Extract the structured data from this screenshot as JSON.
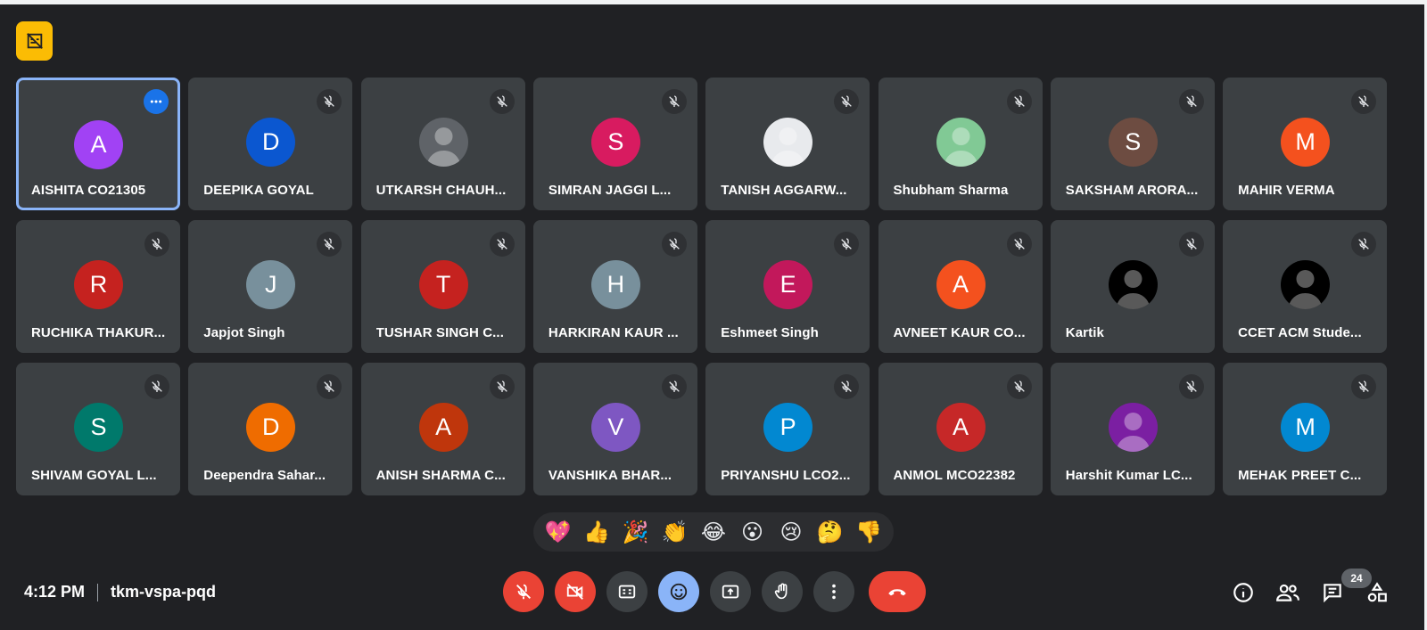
{
  "meeting": {
    "time": "4:12 PM",
    "code": "tkm-vspa-pqd",
    "participant_count": "24"
  },
  "colors": {
    "background": "#202124",
    "tile": "#3c4043",
    "accent": "#8ab4f8",
    "danger": "#ea4335",
    "badge": "#fbbc04"
  },
  "participants": [
    {
      "name": "AISHITA CO21305",
      "initial": "A",
      "color": "#a142f4",
      "active": true
    },
    {
      "name": "DEEPIKA GOYAL",
      "initial": "D",
      "color": "#0b57d0"
    },
    {
      "name": "UTKARSH CHAUH...",
      "initial": "",
      "color": "#5f6368",
      "photo": true
    },
    {
      "name": "SIMRAN JAGGI L...",
      "initial": "S",
      "color": "#d81b60"
    },
    {
      "name": "TANISH AGGARW...",
      "initial": "",
      "color": "#e8eaed",
      "photo": true
    },
    {
      "name": "Shubham Sharma",
      "initial": "",
      "color": "#81c995",
      "photo": true
    },
    {
      "name": "SAKSHAM ARORA...",
      "initial": "S",
      "color": "#6d4c41"
    },
    {
      "name": "MAHIR VERMA",
      "initial": "M",
      "color": "#f4511e"
    },
    {
      "name": "RUCHIKA THAKUR...",
      "initial": "R",
      "color": "#c5221f"
    },
    {
      "name": "Japjot Singh",
      "initial": "J",
      "color": "#78909c"
    },
    {
      "name": "TUSHAR SINGH C...",
      "initial": "T",
      "color": "#c5221f"
    },
    {
      "name": "HARKIRAN KAUR ...",
      "initial": "H",
      "color": "#78909c"
    },
    {
      "name": "Eshmeet Singh",
      "initial": "E",
      "color": "#c2185b"
    },
    {
      "name": "AVNEET KAUR CO...",
      "initial": "A",
      "color": "#f4511e"
    },
    {
      "name": "Kartik",
      "initial": "",
      "color": "#000000",
      "photo": true
    },
    {
      "name": "CCET ACM Stude...",
      "initial": "",
      "color": "#000000",
      "photo": true
    },
    {
      "name": "SHIVAM GOYAL L...",
      "initial": "S",
      "color": "#00796b"
    },
    {
      "name": "Deependra Sahar...",
      "initial": "D",
      "color": "#ef6c00"
    },
    {
      "name": "ANISH SHARMA C...",
      "initial": "A",
      "color": "#bf360c"
    },
    {
      "name": "VANSHIKA BHAR...",
      "initial": "V",
      "color": "#7e57c2"
    },
    {
      "name": "PRIYANSHU LCO2...",
      "initial": "P",
      "color": "#0288d1"
    },
    {
      "name": "ANMOL MCO22382",
      "initial": "A",
      "color": "#c62828"
    },
    {
      "name": "Harshit Kumar LC...",
      "initial": "",
      "color": "#7b1fa2",
      "photo": true
    },
    {
      "name": "MEHAK PREET C...",
      "initial": "M",
      "color": "#0288d1"
    }
  ],
  "reactions": [
    "💖",
    "👍",
    "🎉",
    "👏",
    "😂",
    "😮",
    "😢",
    "🤔",
    "👎"
  ],
  "icons": {
    "badge": "no-captions-icon",
    "controls": [
      "mic-off-icon",
      "camera-off-icon",
      "captions-icon",
      "emoji-icon",
      "present-icon",
      "raise-hand-icon",
      "more-options-icon",
      "end-call-icon"
    ],
    "right": [
      "info-icon",
      "people-icon",
      "chat-icon",
      "activities-icon"
    ]
  }
}
